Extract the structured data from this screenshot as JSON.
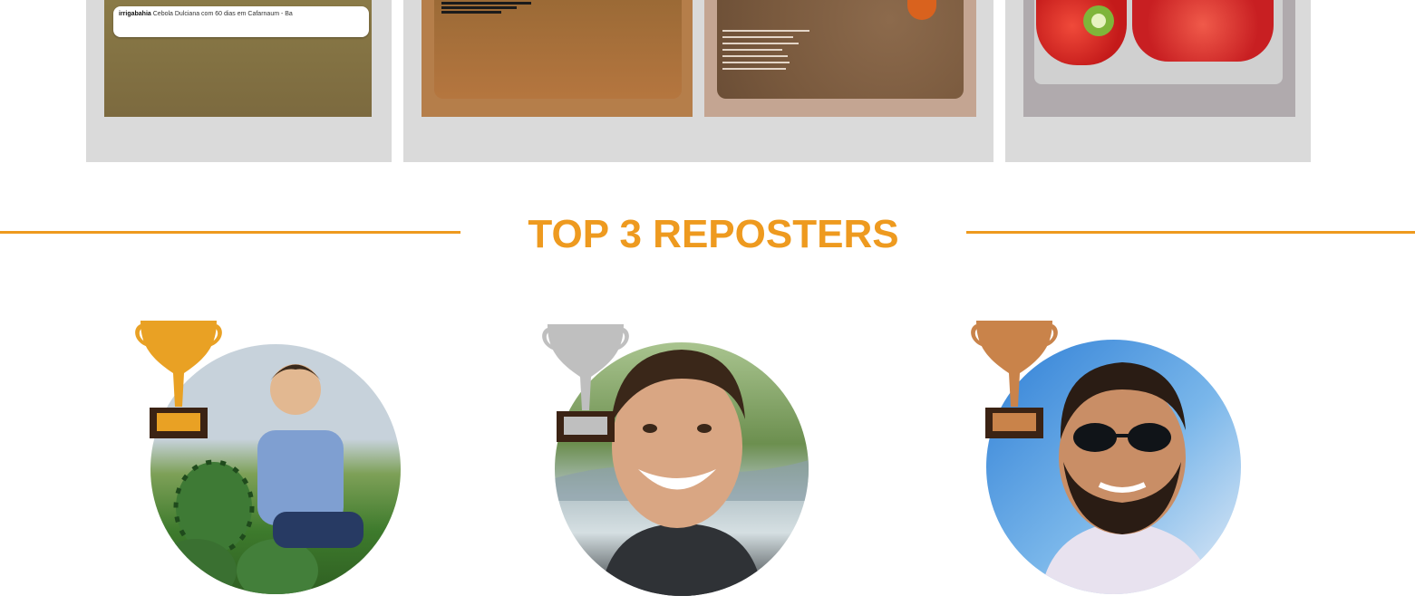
{
  "gallery": {
    "card1": {
      "caption_user": "irrigabahia",
      "caption_text": "Cebola Dulciana com 60 dias em Cafarnaum - Ba"
    }
  },
  "section": {
    "title": "TOP 3 REPOSTERS"
  },
  "trophy_colors": {
    "gold": "#E9A124",
    "silver": "#BFBFBF",
    "bronze": "#C9834A"
  },
  "accent_color": "#EE9A1F"
}
